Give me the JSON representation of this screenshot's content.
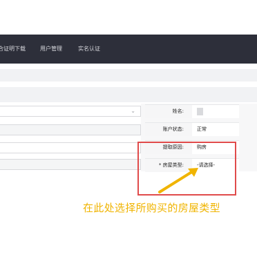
{
  "nav": {
    "items": [
      {
        "label": "合证明下载"
      },
      {
        "label": "用户管理"
      },
      {
        "label": "实名认证"
      }
    ]
  },
  "form": {
    "rows": [
      {
        "label": "姓名:",
        "value": ""
      },
      {
        "label": "账户状态:",
        "value": "正常"
      },
      {
        "label": "提取原因:",
        "value": "购房"
      },
      {
        "label": "* 房屋类型:",
        "value": "-请选择-"
      }
    ]
  },
  "annotation": {
    "text": "在此处选择所购买的房屋类型"
  },
  "colors": {
    "topbar": "#2d2f3a",
    "highlight": "#e04a4a",
    "annotation": "#f0b400"
  }
}
